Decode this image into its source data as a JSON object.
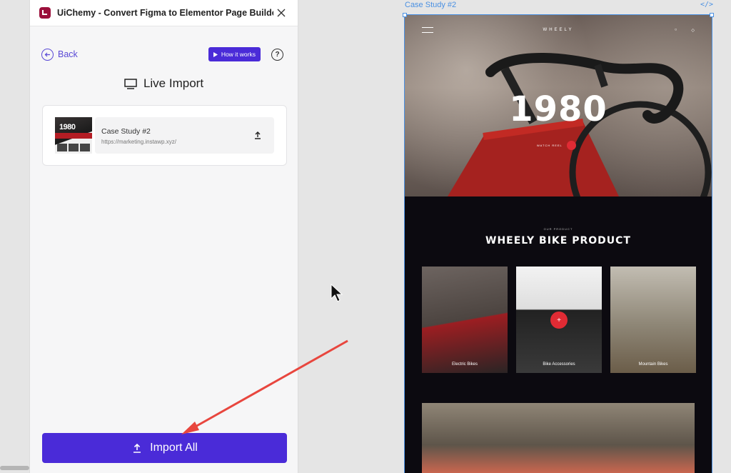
{
  "plugin": {
    "title": "UiChemy - Convert Figma to Elementor Page Builde...",
    "back_label": "Back",
    "how_it_works_label": "How it works",
    "help_symbol": "?",
    "heading": "Live Import",
    "card": {
      "title": "Case Study #2",
      "url": "https://marketing.instawp.xyz/",
      "thumb_text": "1980"
    },
    "import_all_label": "Import All"
  },
  "canvas": {
    "frame_label": "Case Study #2",
    "code_label": "</>",
    "brand": "WHEELY",
    "hero_year": "1980",
    "watch_label": "WATCH REEL",
    "section_tag": "OUR PRODUCT",
    "section_title": "WHEELY BIKE PRODUCT",
    "products": [
      {
        "label": "Electric Bikes"
      },
      {
        "label": "Bike Accessories"
      },
      {
        "label": "Mountain Bikes"
      }
    ]
  },
  "colors": {
    "accent": "#4a2bd8",
    "link": "#5a49d6",
    "logo": "#9b0f3b",
    "selection": "#4a90e2",
    "annotation_arrow": "#e8463e"
  }
}
